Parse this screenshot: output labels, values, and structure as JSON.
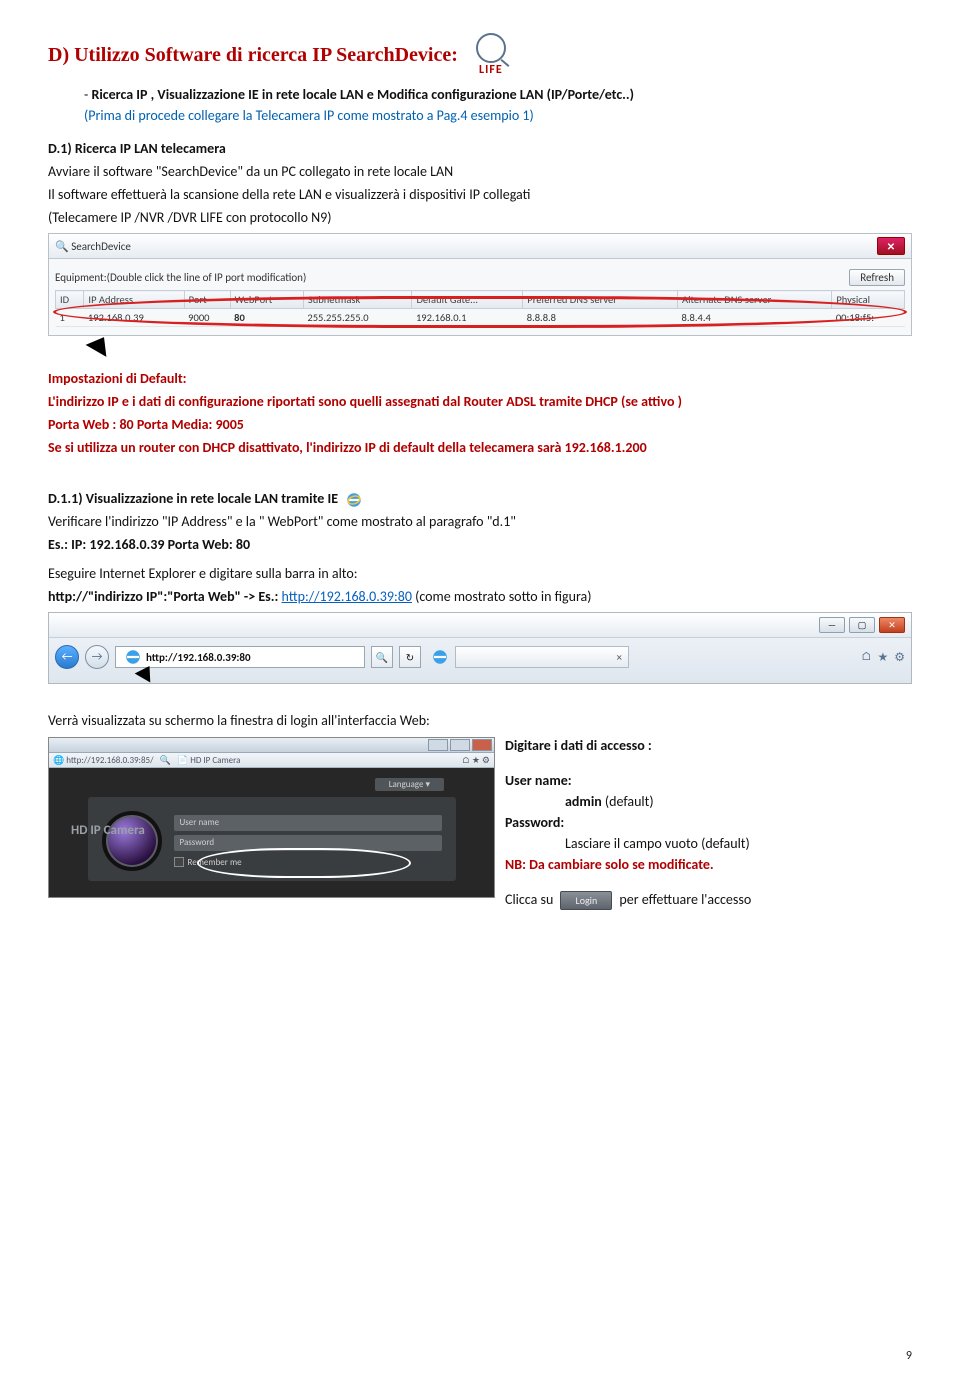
{
  "title": "D) Utilizzo Software di ricerca IP SearchDevice:",
  "logo_text": "LIFE",
  "bullet1": "Ricerca IP , Visualizzazione IE in rete locale LAN e Modifica configurazione LAN (IP/Porte/etc..)",
  "note_blue": "(Prima di procede collegare la Telecamera IP come mostrato a Pag.4 esempio 1)",
  "h_d1": "D.1)  Ricerca IP LAN telecamera",
  "d1_p1": "Avviare il software \"SearchDevice\" da un PC collegato in rete locale LAN",
  "d1_p2": "Il software effettuerà la scansione della rete LAN e visualizzerà i dispositivi IP collegati",
  "d1_p3": "(Telecamere IP /NVR /DVR LIFE con protocollo N9)",
  "search": {
    "title": "SearchDevice",
    "equip": "Equipment:(Double click the line of IP port modification)",
    "refresh": "Refresh",
    "cols": {
      "id": "ID",
      "ip": "IP Address",
      "port": "Port",
      "web": "WebPort",
      "sub": "Subnetmask",
      "gate": "Default Gate...",
      "dns1": "Preferred DNS server",
      "dns2": "Alternate DNS server",
      "phy": "Physical"
    },
    "row": {
      "id": "1",
      "ip": "192.168.0.39",
      "port": "9000",
      "web": "80",
      "sub": "255.255.255.0",
      "gate": "192.168.0.1",
      "dns1": "8.8.8.8",
      "dns2": "8.8.4.4",
      "phy": "00:18:f5:"
    }
  },
  "imp_h": "Impostazioni di Default:",
  "imp_1": "L'indirizzo IP e i dati di configurazione riportati sono quelli assegnati dal Router ADSL tramite DHCP (se attivo )",
  "imp_2": "Porta Web : 80 Porta Media: 9005",
  "imp_3": "Se si utilizza un router con DHCP disattivato, l'indirizzo IP di default della telecamera sarà 192.168.1.200",
  "h_d11": "D.1.1)  Visualizzazione in rete locale LAN tramite IE",
  "d11_p1": "Verificare l'indirizzo \"IP Address\"  e la \" WebPort\" come mostrato al paragrafo \"d.1\"",
  "d11_p2": "Es.: IP: 192.168.0.39  Porta Web: 80",
  "d11_p3": "Eseguire Internet Explorer e digitare sulla barra in alto:",
  "d11_p4a": "http://\"indirizzo IP\":\"Porta  Web\"    ->    Es.: ",
  "d11_link": "http://192.168.0.39:80",
  "d11_p4b": "  (come mostrato sotto in figura)",
  "ie": {
    "url": "http://192.168.0.39:80"
  },
  "after_ie": "Verrà visualizzata su schermo la finestra di login all'interfaccia Web:",
  "login_shot": {
    "addr": "http://192.168.0.39:85/",
    "tab": "HD IP Camera",
    "lang": "Language",
    "hd": "HD IP Camera",
    "f1": "User name",
    "f2": "Password",
    "rem": "Remember me",
    "btn": "Login"
  },
  "rc": {
    "h": "Digitare i dati di accesso :",
    "un_l": "User name:",
    "un_v": "admin",
    "un_d": " (default)",
    "pw_l": "Password:",
    "pw_v": "Lasciare il campo vuoto (default)",
    "nb": "NB: Da cambiare solo se modificate.",
    "click_a": "Clicca su ",
    "click_b": " per effettuare l'accesso",
    "login_btn": "Login"
  },
  "page": "9"
}
